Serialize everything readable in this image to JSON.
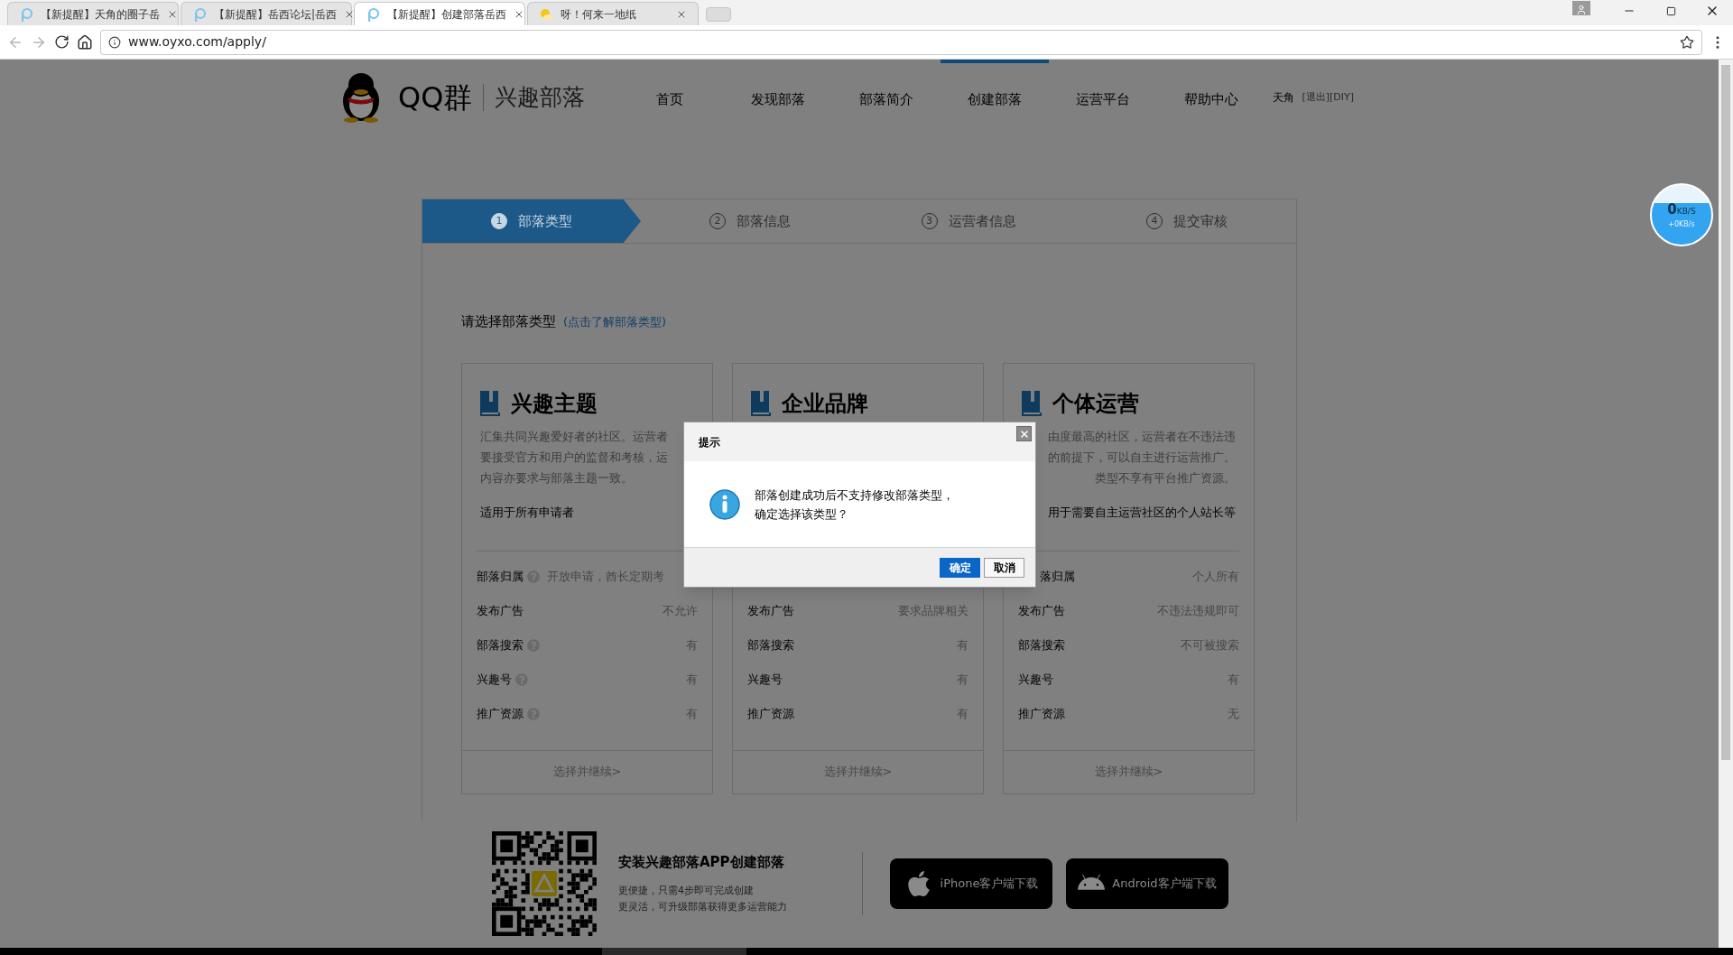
{
  "browser": {
    "tabs": [
      {
        "title": "【新提醒】天角的圈子岳",
        "selected": false,
        "kind": "site"
      },
      {
        "title": "【新提醒】岳西论坛|岳西",
        "selected": false,
        "kind": "site"
      },
      {
        "title": "【新提醒】创建部落岳西",
        "selected": true,
        "kind": "site"
      },
      {
        "title": "呀！何来一地纸",
        "selected": false,
        "kind": "sun"
      }
    ],
    "address": "www.oyxo.com/apply/"
  },
  "header": {
    "logo_text": "QQ群",
    "logo_sub": "兴趣部落",
    "nav": [
      {
        "label": "首页",
        "selected": false
      },
      {
        "label": "发现部落",
        "selected": false
      },
      {
        "label": "部落简介",
        "selected": false
      },
      {
        "label": "创建部落",
        "selected": true
      },
      {
        "label": "运营平台",
        "selected": false
      },
      {
        "label": "帮助中心",
        "selected": false
      }
    ],
    "user": "天角",
    "user_links": "[退出][DIY]"
  },
  "steps": [
    {
      "number": "1",
      "label": "部落类型",
      "selected": true
    },
    {
      "number": "2",
      "label": "部落信息",
      "selected": false
    },
    {
      "number": "3",
      "label": "运营者信息",
      "selected": false
    },
    {
      "number": "4",
      "label": "提交审核",
      "selected": false
    }
  ],
  "prompt": {
    "text": "请选择部落类型",
    "link": "(点击了解部落类型)"
  },
  "cards": [
    {
      "title": "兴趣主题",
      "description": [
        "汇集共同兴趣爱好者的社区。运营者",
        "要接受官方和用户的监督和考核，运",
        "内容亦要求与部落主题一致。"
      ],
      "audience": "适用于所有申请者",
      "rows": [
        {
          "label": "部落归属",
          "help": true,
          "value": "开放申请，酋长定期考"
        },
        {
          "label": "发布广告",
          "help": false,
          "value": "不允许"
        },
        {
          "label": "部落搜索",
          "help": true,
          "value": "有"
        },
        {
          "label": "兴趣号",
          "help": true,
          "value": "有"
        },
        {
          "label": "推广资源",
          "help": true,
          "value": "有"
        }
      ],
      "action": "选择并继续>"
    },
    {
      "title": "企业品牌",
      "rows": [
        {
          "label": "发布广告",
          "help": false,
          "value": "要求品牌相关"
        },
        {
          "label": "部落搜索",
          "help": false,
          "value": "有"
        },
        {
          "label": "兴趣号",
          "help": false,
          "value": "有"
        },
        {
          "label": "推广资源",
          "help": false,
          "value": "有"
        }
      ],
      "action": "选择并继续>"
    },
    {
      "title": "个体运营",
      "description": [
        "由度最高的社区，运营者在不违法违",
        "的前提下，可以自主进行运营推广。",
        "类型不享有平台推广资源。"
      ],
      "audience": "用于需要自主运营社区的个人站长等",
      "rows": [
        {
          "label": "落归属",
          "help": false,
          "value": "个人所有"
        },
        {
          "label": "发布广告",
          "help": false,
          "value": "不违法违规即可"
        },
        {
          "label": "部落搜索",
          "help": false,
          "value": "不可被搜索"
        },
        {
          "label": "兴趣号",
          "help": false,
          "value": "有"
        },
        {
          "label": "推广资源",
          "help": false,
          "value": "无"
        }
      ],
      "action": "选择并继续>"
    }
  ],
  "app_promo": {
    "title": "安装兴趣部落APP创建部落",
    "lines": [
      "更便捷，只需4步即可完成创建",
      "更灵活，可升级部落获得更多运营能力"
    ],
    "buttons": [
      {
        "kind": "apple",
        "label": "iPhone客户端下载"
      },
      {
        "kind": "android",
        "label": "Android客户端下载"
      }
    ]
  },
  "net_widget": {
    "speed": "0",
    "unit": "KB/S",
    "upload": "+0KB/s"
  },
  "dialog": {
    "title": "提示",
    "message": [
      "部落创建成功后不支持修改部落类型，",
      "确定选择该类型？"
    ],
    "buttons": [
      {
        "kind": "primary",
        "label": "确定"
      },
      {
        "kind": "default",
        "label": "取消"
      }
    ]
  }
}
